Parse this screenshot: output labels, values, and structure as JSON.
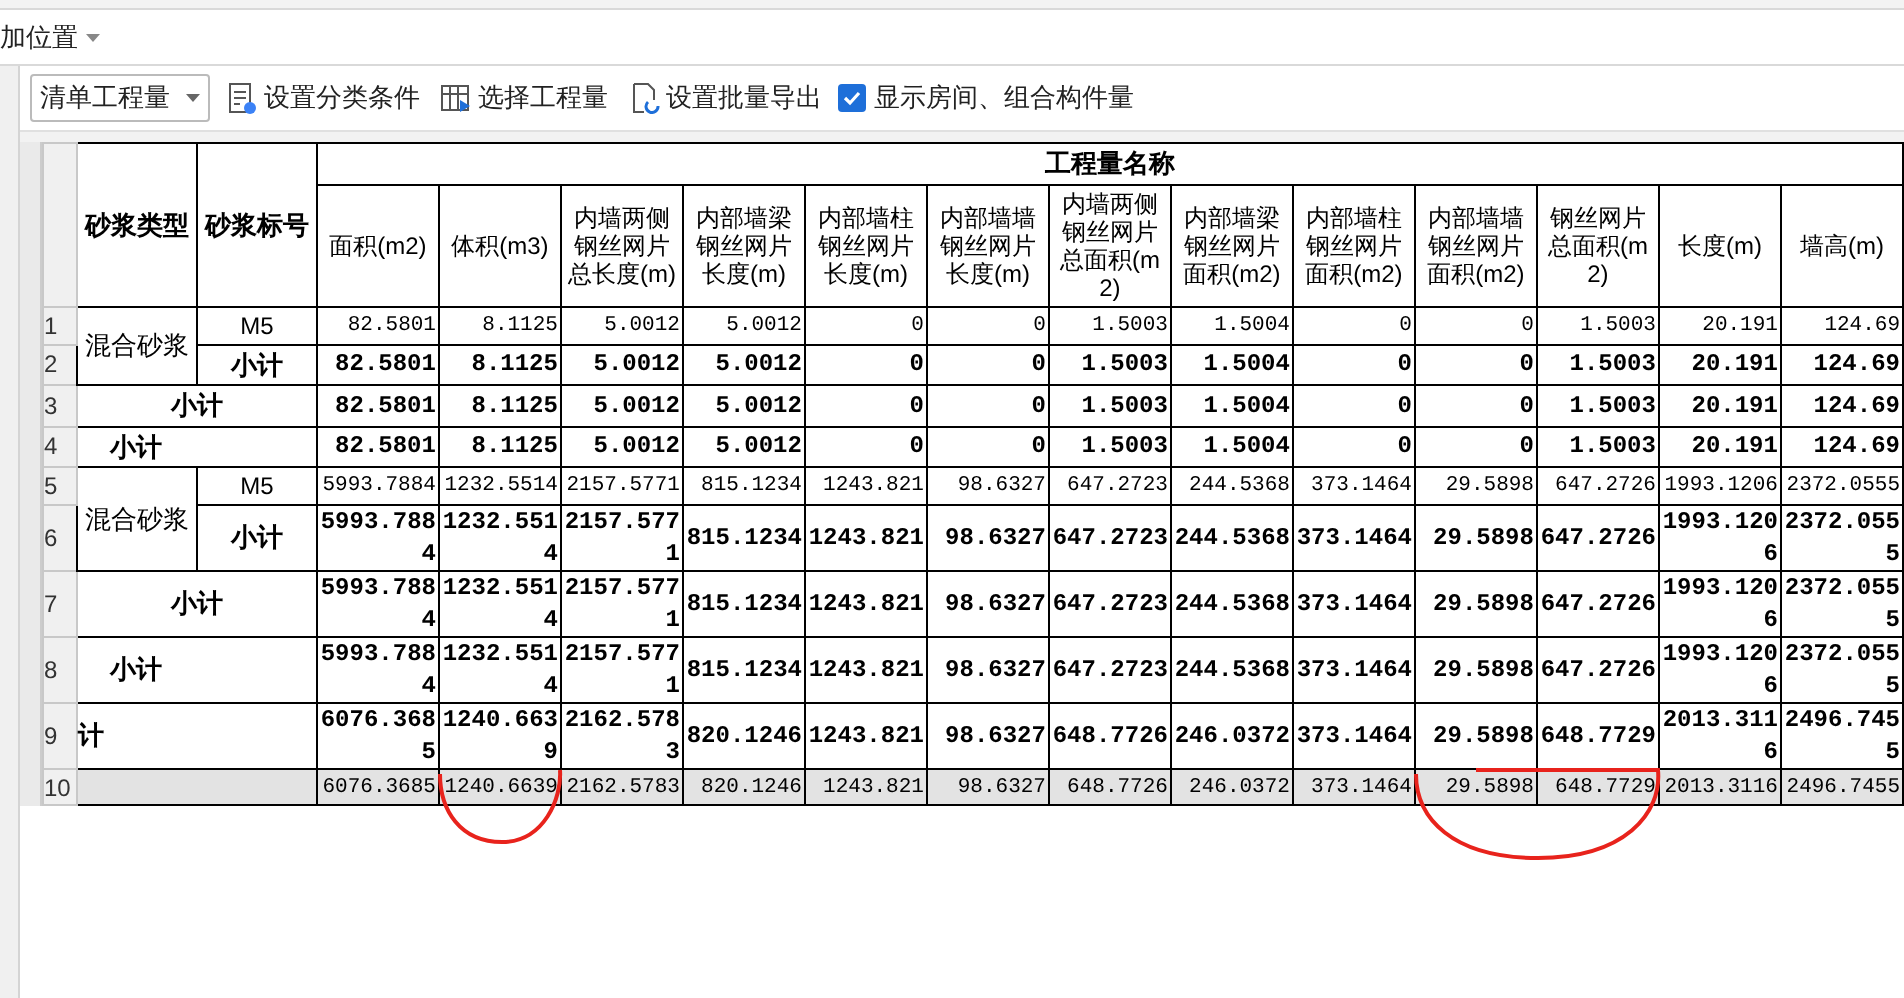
{
  "top_menu": {
    "label": "加位置"
  },
  "toolbar": {
    "dropdown": "清单工程量",
    "buttons": [
      "设置分类条件",
      "选择工程量",
      "设置批量导出"
    ],
    "checkbox": {
      "label": "显示房间、组合构件量",
      "checked": true
    }
  },
  "table": {
    "label_headers": [
      "砂浆类型",
      "砂浆标号"
    ],
    "group_header": "工程量名称",
    "columns": [
      "面积(m2)",
      "体积(m3)",
      "内墙两侧钢丝网片总长度(m)",
      "内部墙梁钢丝网片长度(m)",
      "内部墙柱钢丝网片长度(m)",
      "内部墙墙钢丝网片长度(m)",
      "内墙两侧钢丝网片总面积(m2)",
      "内部墙梁钢丝网片面积(m2)",
      "内部墙柱钢丝网片面积(m2)",
      "内部墙墙钢丝网片面积(m2)",
      "钢丝网片总面积(m2)",
      "长度(m)",
      "墙高(m)"
    ],
    "rows": [
      {
        "number": "1",
        "kind": "group",
        "type": "混合砂浆",
        "grade": "M5",
        "bold": false,
        "values": [
          "82.5801",
          "8.1125",
          "5.0012",
          "5.0012",
          "0",
          "0",
          "1.5003",
          "1.5004",
          "0",
          "0",
          "1.5003",
          "20.191",
          "124.69"
        ]
      },
      {
        "number": "2",
        "kind": "grade",
        "grade": "小计",
        "bold": true,
        "values": [
          "82.5801",
          "8.1125",
          "5.0012",
          "5.0012",
          "0",
          "0",
          "1.5003",
          "1.5004",
          "0",
          "0",
          "1.5003",
          "20.191",
          "124.69"
        ]
      },
      {
        "number": "3",
        "kind": "subtotal",
        "label": "小计",
        "bold": true,
        "values": [
          "82.5801",
          "8.1125",
          "5.0012",
          "5.0012",
          "0",
          "0",
          "1.5003",
          "1.5004",
          "0",
          "0",
          "1.5003",
          "20.191",
          "124.69"
        ]
      },
      {
        "number": "4",
        "kind": "subtotal_indent",
        "label": "小计",
        "bold": true,
        "values": [
          "82.5801",
          "8.1125",
          "5.0012",
          "5.0012",
          "0",
          "0",
          "1.5003",
          "1.5004",
          "0",
          "0",
          "1.5003",
          "20.191",
          "124.69"
        ]
      },
      {
        "number": "5",
        "kind": "group",
        "type": "混合砂浆",
        "grade": "M5",
        "bold": false,
        "values": [
          "5993.7884",
          "1232.5514",
          "2157.5771",
          "815.1234",
          "1243.821",
          "98.6327",
          "647.2723",
          "244.5368",
          "373.1464",
          "29.5898",
          "647.2726",
          "1993.1206",
          "2372.0555"
        ]
      },
      {
        "number": "6",
        "kind": "grade",
        "grade": "小计",
        "bold": true,
        "values": [
          "5993.7884",
          "1232.5514",
          "2157.5771",
          "815.1234",
          "1243.821",
          "98.6327",
          "647.2723",
          "244.5368",
          "373.1464",
          "29.5898",
          "647.2726",
          "1993.1206",
          "2372.0555"
        ]
      },
      {
        "number": "7",
        "kind": "subtotal",
        "label": "小计",
        "bold": true,
        "values": [
          "5993.7884",
          "1232.5514",
          "2157.5771",
          "815.1234",
          "1243.821",
          "98.6327",
          "647.2723",
          "244.5368",
          "373.1464",
          "29.5898",
          "647.2726",
          "1993.1206",
          "2372.0555"
        ]
      },
      {
        "number": "8",
        "kind": "subtotal_indent",
        "label": "小计",
        "bold": true,
        "values": [
          "5993.7884",
          "1232.5514",
          "2157.5771",
          "815.1234",
          "1243.821",
          "98.6327",
          "647.2723",
          "244.5368",
          "373.1464",
          "29.5898",
          "647.2726",
          "1993.1206",
          "2372.0555"
        ]
      },
      {
        "number": "9",
        "kind": "total",
        "text": "计",
        "bold": true,
        "values": [
          "6076.3685",
          "1240.6639",
          "2162.5783",
          "820.1246",
          "1243.821",
          "98.6327",
          "648.7726",
          "246.0372",
          "373.1464",
          "29.5898",
          "648.7729",
          "2013.3116",
          "2496.7455"
        ]
      },
      {
        "number": "10",
        "kind": "footer",
        "bold": false,
        "values": [
          "6076.3685",
          "1240.6639",
          "2162.5783",
          "820.1246",
          "1243.821",
          "98.6327",
          "648.7726",
          "246.0372",
          "373.1464",
          "29.5898",
          "648.7729",
          "2013.3116",
          "2496.7455"
        ]
      }
    ]
  }
}
